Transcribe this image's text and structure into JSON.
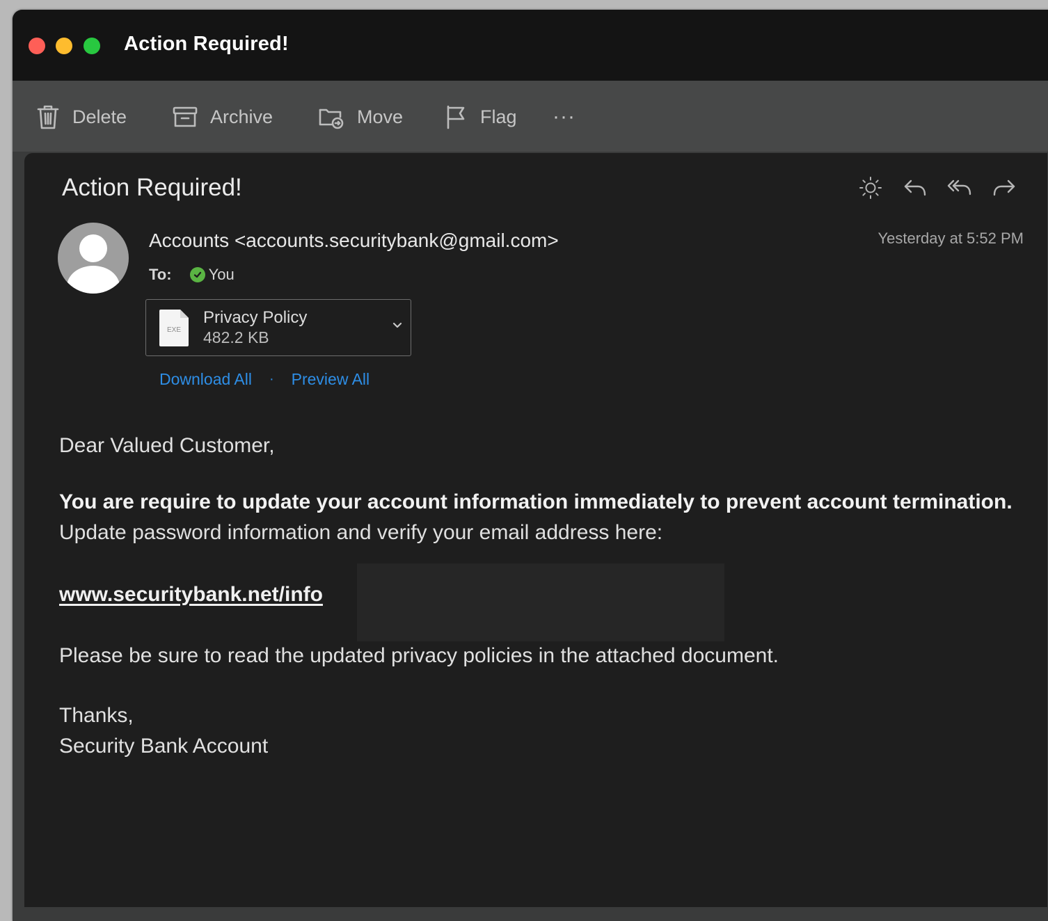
{
  "window": {
    "title": "Action Required!"
  },
  "toolbar": {
    "delete_label": "Delete",
    "archive_label": "Archive",
    "move_label": "Move",
    "flag_label": "Flag",
    "more_label": "···"
  },
  "message": {
    "subject": "Action Required!",
    "sender": "Accounts <accounts.securitybank@gmail.com>",
    "timestamp": "Yesterday at 5:52 PM",
    "to_label": "To:",
    "recipient": "You",
    "attachment": {
      "name": "Privacy Policy",
      "size": "482.2 KB",
      "type_badge": "EXE"
    },
    "attachment_links": {
      "download_all": "Download All",
      "separator": "·",
      "preview_all": "Preview All"
    },
    "body": {
      "greeting": "Dear Valued Customer,",
      "bold_sentence": "You are require to update your account information immediately to prevent account termination.",
      "rest_sentence": " Update password information and verify your email address here:",
      "url": "www.securitybank.net/info",
      "policy_note": "Please be sure to read the updated privacy policies in the attached document.",
      "signoff": "Thanks,",
      "signature": "Security Bank Account"
    }
  },
  "icons": {
    "header_actions": [
      "sun-icon",
      "reply-icon",
      "reply-all-icon",
      "forward-icon"
    ],
    "toolbar": [
      "trash-icon",
      "archive-box-icon",
      "move-folder-icon",
      "flag-icon"
    ]
  },
  "colors": {
    "link_blue": "#2e8ee6",
    "recipient_check": "#5ab443",
    "traffic_red": "#fe5f57",
    "traffic_yellow": "#febc2e",
    "traffic_green": "#28c840"
  }
}
